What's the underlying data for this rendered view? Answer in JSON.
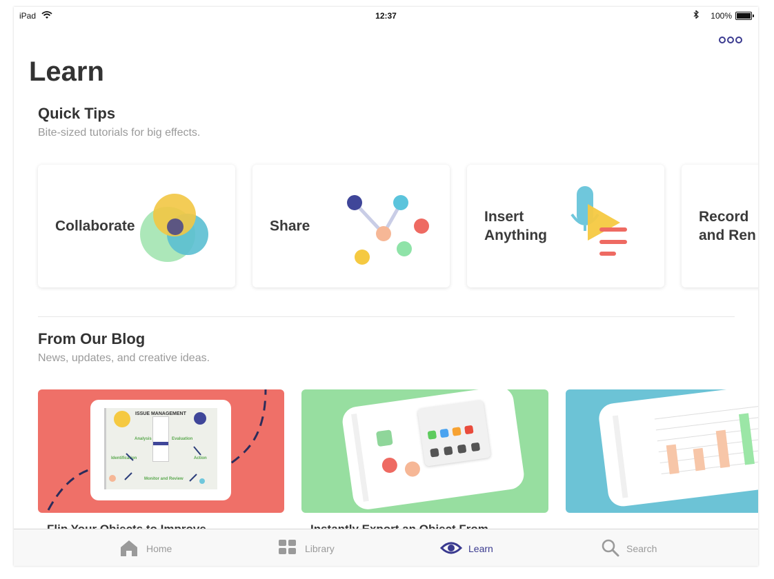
{
  "status_bar": {
    "device": "iPad",
    "time": "12:37",
    "battery": "100%"
  },
  "page": {
    "title": "Learn"
  },
  "quick_tips": {
    "title": "Quick Tips",
    "subtitle": "Bite-sized tutorials for big effects.",
    "cards": [
      {
        "label": "Collaborate",
        "art": "venn-circles"
      },
      {
        "label": "Share",
        "art": "network-nodes"
      },
      {
        "label": "Insert\nAnything",
        "art": "mic-play-lines"
      },
      {
        "label": "Record\nand Ren"
      }
    ]
  },
  "blog": {
    "title": "From Our Blog",
    "subtitle": "News, updates, and creative ideas.",
    "cards": [
      {
        "caption": "Flip Your Objects to Improve",
        "color": "#ef7068",
        "image_text": {
          "heading": "ISSUE MANAGEMENT",
          "nodes": [
            "Analysis",
            "Evaluation",
            "Identification",
            "Action",
            "Monitor and Review"
          ]
        }
      },
      {
        "caption": "Instantly Export an Object From",
        "color": "#97dea0"
      },
      {
        "caption": "",
        "color": "#6cc3d6"
      }
    ]
  },
  "tab_bar": {
    "tabs": [
      {
        "label": "Home",
        "icon": "home-icon",
        "active": false
      },
      {
        "label": "Library",
        "icon": "grid-icon",
        "active": false
      },
      {
        "label": "Learn",
        "icon": "eye-icon",
        "active": true
      },
      {
        "label": "Search",
        "icon": "search-icon",
        "active": false
      }
    ]
  },
  "colors": {
    "accent": "#3a3a8f",
    "inactive": "#9a9a9a"
  }
}
